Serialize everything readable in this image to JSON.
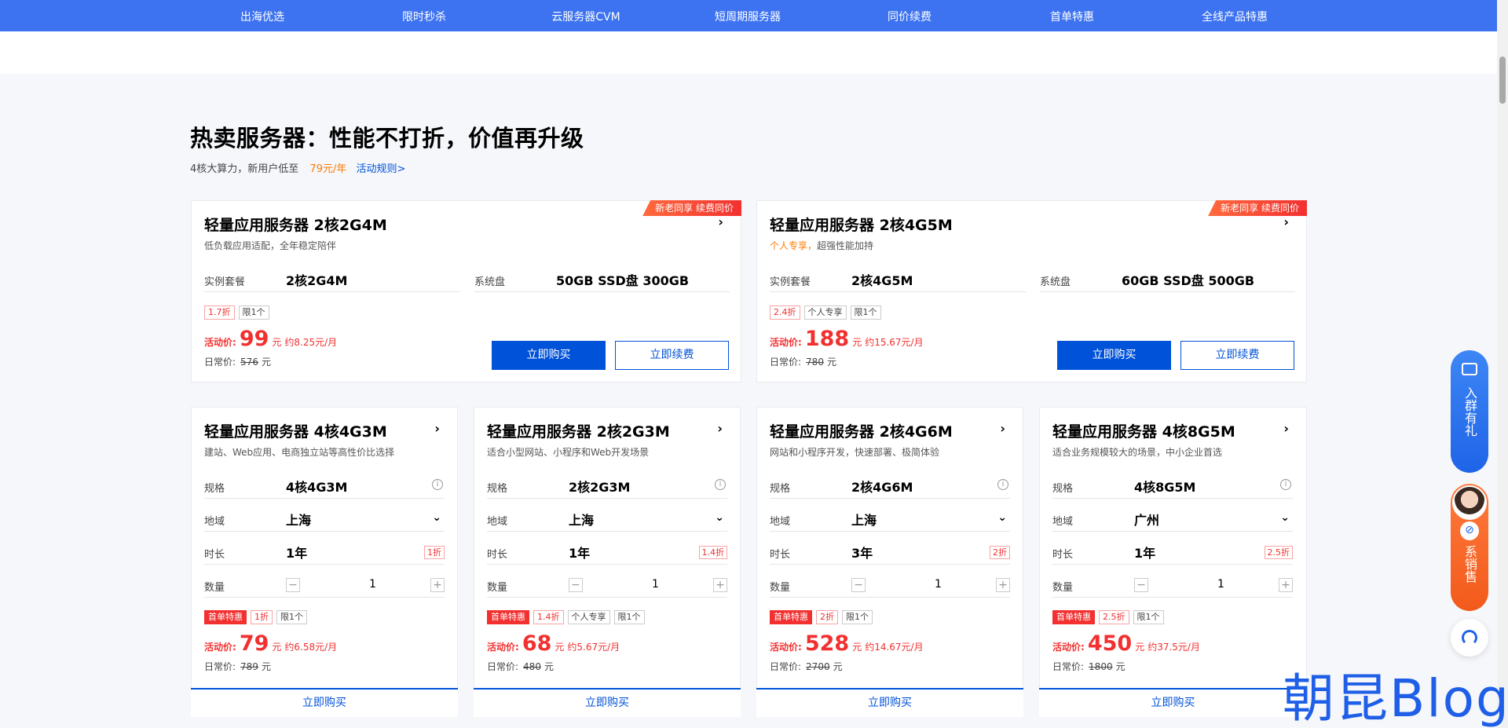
{
  "nav": [
    "出海优选",
    "限时秒杀",
    "云服务器CVM",
    "短周期服务器",
    "同价续费",
    "首单特惠",
    "全线产品特惠"
  ],
  "section": {
    "title": "热卖服务器：性能不打折，价值再升级",
    "sub_text": "4核大算力，新用户低至",
    "sub_price": "79元/年",
    "sub_link": "活动规则>"
  },
  "top_cards": [
    {
      "ribbon": "新老同享 续费同价",
      "title": "轻量应用服务器 2核2G4M",
      "desc_orange": "",
      "desc": "低负载应用适配，全年稳定陪伴",
      "spec_label": "实例套餐",
      "spec_value": "2核2G4M",
      "disk_label": "系统盘",
      "disk_value": "50GB SSD盘 300GB",
      "tags": [
        "1.7折",
        "限1个"
      ],
      "price_label": "活动价:",
      "price": "99",
      "unit": "元",
      "monthly": "约8.25元/月",
      "orig_label": "日常价:",
      "orig": "576",
      "orig_unit": "元",
      "buy": "立即购买",
      "renew": "立即续费"
    },
    {
      "ribbon": "新老同享 续费同价",
      "title": "轻量应用服务器 2核4G5M",
      "desc_orange": "个人专享，",
      "desc": "超强性能加持",
      "spec_label": "实例套餐",
      "spec_value": "2核4G5M",
      "disk_label": "系统盘",
      "disk_value": "60GB SSD盘 500GB",
      "tags": [
        "2.4折",
        "个人专享",
        "限1个"
      ],
      "price_label": "活动价:",
      "price": "188",
      "unit": "元",
      "monthly": "约15.67元/月",
      "orig_label": "日常价:",
      "orig": "780",
      "orig_unit": "元",
      "buy": "立即购买",
      "renew": "立即续费"
    }
  ],
  "cards": [
    {
      "title": "轻量应用服务器 4核4G3M",
      "desc": "建站、Web应用、电商独立站等高性价比选择",
      "spec_label": "规格",
      "spec": "4核4G3M",
      "region_label": "地域",
      "region": "上海",
      "duration_label": "时长",
      "duration": "1年",
      "duration_disc": "1折",
      "qty_label": "数量",
      "qty": "1",
      "tags": [
        "首单特惠",
        "1折",
        "限1个"
      ],
      "price_label": "活动价:",
      "price": "79",
      "unit": "元",
      "monthly": "约6.58元/月",
      "orig_label": "日常价:",
      "orig": "789",
      "orig_unit": "元",
      "buy": "立即购买"
    },
    {
      "title": "轻量应用服务器 2核2G3M",
      "desc": "适合小型网站、小程序和Web开发场景",
      "spec_label": "规格",
      "spec": "2核2G3M",
      "region_label": "地域",
      "region": "上海",
      "duration_label": "时长",
      "duration": "1年",
      "duration_disc": "1.4折",
      "qty_label": "数量",
      "qty": "1",
      "tags": [
        "首单特惠",
        "1.4折",
        "个人专享",
        "限1个"
      ],
      "price_label": "活动价:",
      "price": "68",
      "unit": "元",
      "monthly": "约5.67元/月",
      "orig_label": "日常价:",
      "orig": "480",
      "orig_unit": "元",
      "buy": "立即购买"
    },
    {
      "title": "轻量应用服务器 2核4G6M",
      "desc": "网站和小程序开发，快速部署、极简体验",
      "spec_label": "规格",
      "spec": "2核4G6M",
      "region_label": "地域",
      "region": "上海",
      "duration_label": "时长",
      "duration": "3年",
      "duration_disc": "2折",
      "qty_label": "数量",
      "qty": "1",
      "tags": [
        "首单特惠",
        "2折",
        "限1个"
      ],
      "price_label": "活动价:",
      "price": "528",
      "unit": "元",
      "monthly": "约14.67元/月",
      "orig_label": "日常价:",
      "orig": "2700",
      "orig_unit": "元",
      "buy": "立即购买"
    },
    {
      "title": "轻量应用服务器 4核8G5M",
      "desc": "适合业务规模较大的场景，中小企业首选",
      "spec_label": "规格",
      "spec": "4核8G5M",
      "region_label": "地域",
      "region": "广州",
      "duration_label": "时长",
      "duration": "1年",
      "duration_disc": "2.5折",
      "qty_label": "数量",
      "qty": "1",
      "tags": [
        "首单特惠",
        "2.5折",
        "限1个"
      ],
      "price_label": "活动价:",
      "price": "450",
      "unit": "元",
      "monthly": "约37.5元/月",
      "orig_label": "日常价:",
      "orig": "1800",
      "orig_unit": "元",
      "buy": "立即购买"
    }
  ],
  "side": {
    "group_text": "入群有礼",
    "sales_text": "系销售"
  },
  "watermark": "朝昆Blog"
}
